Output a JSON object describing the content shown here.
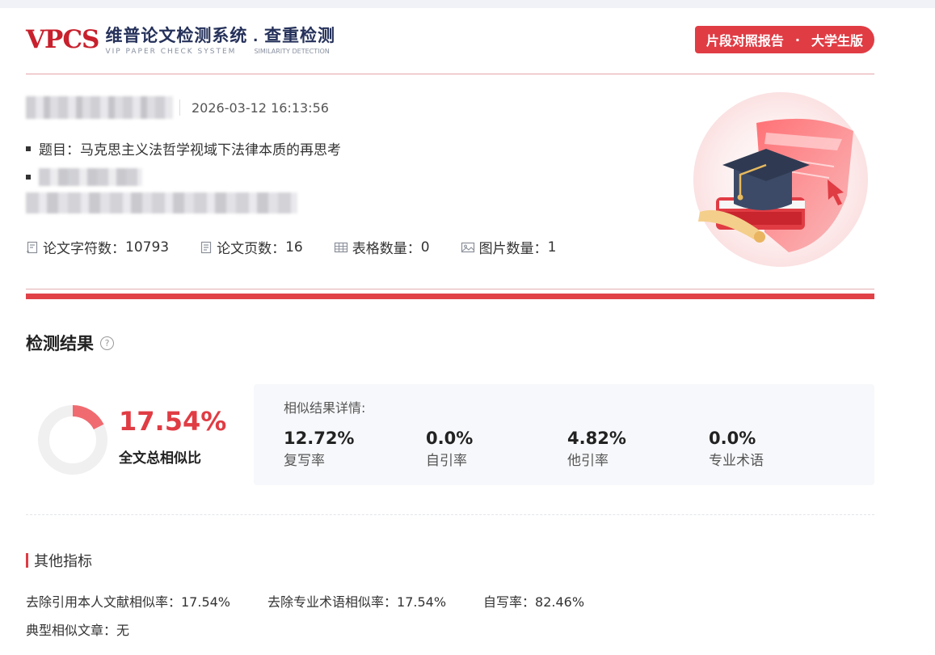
{
  "header": {
    "logo_mark": "VPCS",
    "logo_cn": "维普论文检测系统 . 查重检测",
    "logo_en": "VIP PAPER CHECK SYSTEM",
    "logo_en_sub": "SIMILARITY DETECTION",
    "badge_left": "片段对照报告",
    "badge_dot": "·",
    "badge_right": "大学生版"
  },
  "info": {
    "datetime": "2026-03-12 16:13:56",
    "title_label": "题目：",
    "title_value": "马克思主义法哲学视域下法律本质的再思考"
  },
  "stats": [
    {
      "icon": "doc-chars-icon",
      "label": "论文字符数：",
      "value": "10793"
    },
    {
      "icon": "doc-pages-icon",
      "label": "论文页数：",
      "value": "16"
    },
    {
      "icon": "table-icon",
      "label": "表格数量：",
      "value": "0"
    },
    {
      "icon": "image-icon",
      "label": "图片数量：",
      "value": "1"
    }
  ],
  "results": {
    "section_title": "检测结果",
    "help_icon": "?",
    "total_value": "17.54%",
    "total_fraction": 0.1754,
    "total_label": "全文总相似比",
    "detail_head": "相似结果详情:",
    "metrics": [
      {
        "value": "12.72%",
        "label": "复写率"
      },
      {
        "value": "0.0%",
        "label": "自引率"
      },
      {
        "value": "4.82%",
        "label": "他引率"
      },
      {
        "value": "0.0%",
        "label": "专业术语"
      }
    ]
  },
  "other": {
    "title": "其他指标",
    "items": [
      "去除引用本人文献相似率：17.54%",
      "去除专业术语相似率：17.54%",
      "自写率：82.46%",
      "典型相似文章：无"
    ]
  },
  "colors": {
    "accent": "#e03c44",
    "navy": "#25315a"
  }
}
